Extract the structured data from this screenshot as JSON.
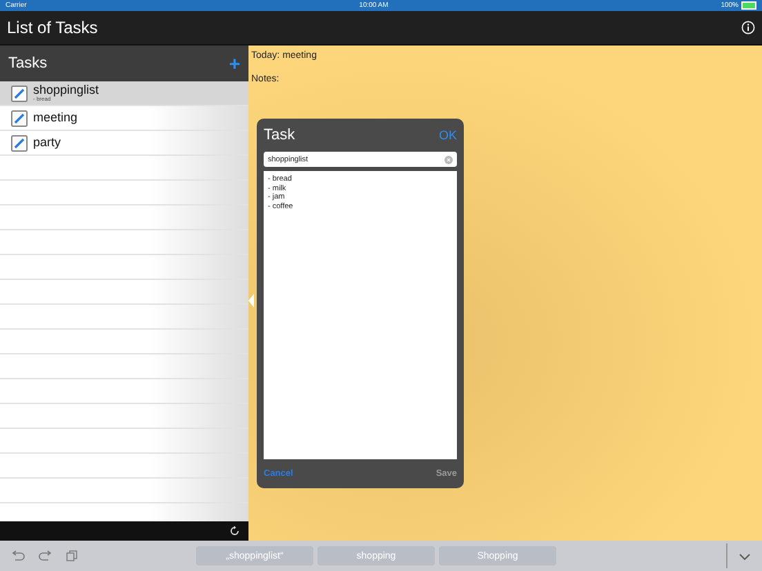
{
  "status_bar": {
    "carrier": "Carrier",
    "time": "10:00 AM",
    "battery": "100%"
  },
  "nav_bar": {
    "title": "List of Tasks"
  },
  "sidebar": {
    "title": "Tasks",
    "add": "+",
    "items": [
      {
        "title": "shoppinglist",
        "subtitle": "- bread",
        "selected": true
      },
      {
        "title": "meeting",
        "selected": false
      },
      {
        "title": "party",
        "selected": false
      }
    ]
  },
  "detail": {
    "today": "Today: meeting",
    "notes_label": "Notes:"
  },
  "dialog": {
    "title": "Task",
    "ok": "OK",
    "name_value": "shoppinglist",
    "notes": "- bread\n- milk\n- jam\n- coffee",
    "cancel": "Cancel",
    "save": "Save",
    "save_disabled": true
  },
  "keyboard_bar": {
    "suggestions": [
      "„shoppinglist“",
      "shopping",
      "Shopping"
    ]
  }
}
